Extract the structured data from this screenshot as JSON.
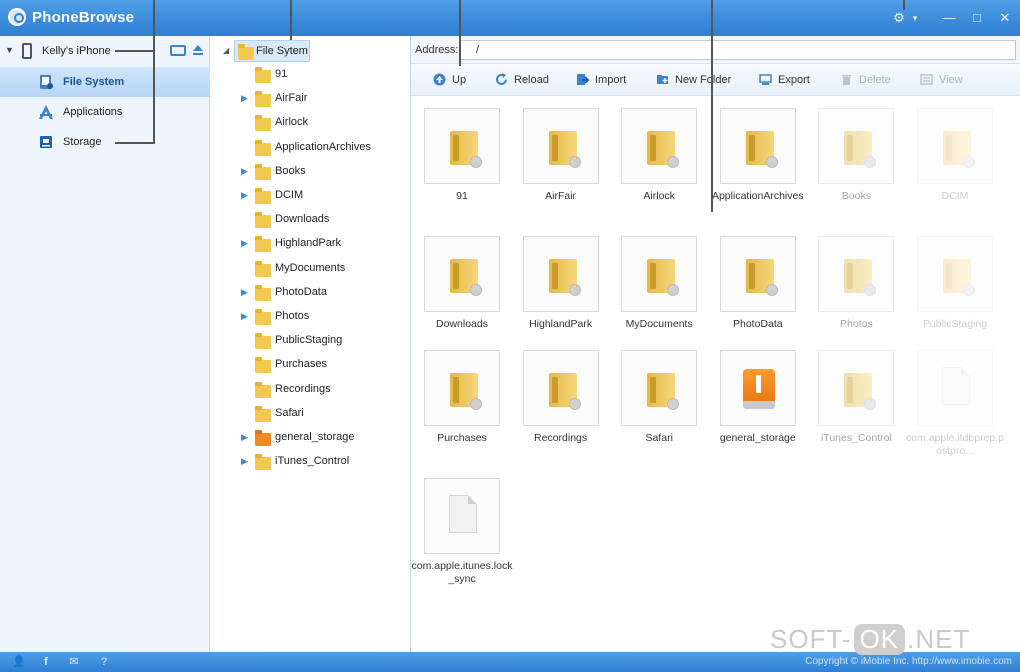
{
  "window": {
    "title": "PhoneBrowse"
  },
  "sidebar": {
    "device_name": "Kelly's iPhone",
    "items": [
      {
        "label": "File System",
        "active": true
      },
      {
        "label": "Applications",
        "active": false
      },
      {
        "label": "Storage",
        "active": false
      }
    ]
  },
  "tree": {
    "root_label": "File Sytem",
    "items": [
      {
        "label": "91",
        "expandable": false,
        "type": "folder"
      },
      {
        "label": "AirFair",
        "expandable": true,
        "type": "folder"
      },
      {
        "label": "Airlock",
        "expandable": false,
        "type": "folder"
      },
      {
        "label": "ApplicationArchives",
        "expandable": false,
        "type": "folder"
      },
      {
        "label": "Books",
        "expandable": true,
        "type": "folder"
      },
      {
        "label": "DCIM",
        "expandable": true,
        "type": "folder"
      },
      {
        "label": "Downloads",
        "expandable": false,
        "type": "folder"
      },
      {
        "label": "HighlandPark",
        "expandable": true,
        "type": "folder"
      },
      {
        "label": "MyDocuments",
        "expandable": false,
        "type": "folder"
      },
      {
        "label": "PhotoData",
        "expandable": true,
        "type": "folder"
      },
      {
        "label": "Photos",
        "expandable": true,
        "type": "folder"
      },
      {
        "label": "PublicStaging",
        "expandable": false,
        "type": "folder"
      },
      {
        "label": "Purchases",
        "expandable": false,
        "type": "folder"
      },
      {
        "label": "Recordings",
        "expandable": false,
        "type": "folder"
      },
      {
        "label": "Safari",
        "expandable": false,
        "type": "folder"
      },
      {
        "label": "general_storage",
        "expandable": true,
        "type": "storage"
      },
      {
        "label": "iTunes_Control",
        "expandable": true,
        "type": "folder"
      }
    ]
  },
  "address": {
    "label": "Address:",
    "value": "/"
  },
  "toolbar": {
    "up": "Up",
    "reload": "Reload",
    "import": "Import",
    "new_folder": "New Folder",
    "export": "Export",
    "delete": "Delete",
    "view": "View"
  },
  "files": [
    {
      "label": "91",
      "kind": "folder",
      "state": "normal"
    },
    {
      "label": "AirFair",
      "kind": "folder",
      "state": "normal"
    },
    {
      "label": "Airlock",
      "kind": "folder",
      "state": "normal"
    },
    {
      "label": "ApplicationArchives",
      "kind": "folder",
      "state": "normal"
    },
    {
      "label": "Books",
      "kind": "folder",
      "state": "faded"
    },
    {
      "label": "DCIM",
      "kind": "folder",
      "state": "faded2"
    },
    {
      "label": "Downloads",
      "kind": "folder",
      "state": "normal"
    },
    {
      "label": "HighlandPark",
      "kind": "folder",
      "state": "normal"
    },
    {
      "label": "MyDocuments",
      "kind": "folder",
      "state": "normal"
    },
    {
      "label": "PhotoData",
      "kind": "folder",
      "state": "normal"
    },
    {
      "label": "Photos",
      "kind": "folder",
      "state": "faded"
    },
    {
      "label": "PublicStaging",
      "kind": "folder",
      "state": "faded2"
    },
    {
      "label": "Purchases",
      "kind": "folder",
      "state": "normal"
    },
    {
      "label": "Recordings",
      "kind": "folder",
      "state": "normal"
    },
    {
      "label": "Safari",
      "kind": "folder",
      "state": "normal"
    },
    {
      "label": "general_storage",
      "kind": "usb",
      "state": "normal"
    },
    {
      "label": "iTunes_Control",
      "kind": "folder",
      "state": "faded"
    },
    {
      "label": "com.apple.itdbprep.postpro...",
      "kind": "doc",
      "state": "faded2"
    },
    {
      "label": "com.apple.itunes.lock_sync",
      "kind": "doc",
      "state": "normal"
    }
  ],
  "statusbar": {
    "copyright": "Copyright © iMobie Inc. http://www.imobie.com"
  },
  "watermark": {
    "left": "SOFT-",
    "box": "OK",
    "right": ".NET"
  },
  "colors": {
    "titlebar": "#2f7fd3",
    "sidebar_bg": "#eef5fc",
    "active_item": "#b8d6f5",
    "folder": "#f2c94c"
  }
}
